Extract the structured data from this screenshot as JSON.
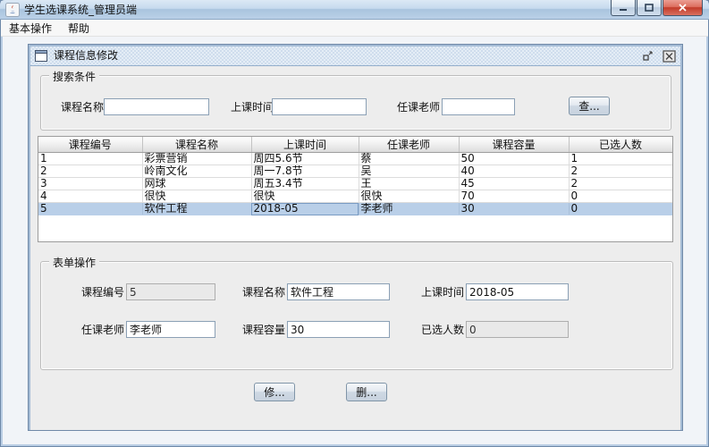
{
  "window": {
    "title": "学生选课系统_管理员端"
  },
  "menu": {
    "items": [
      {
        "label": "基本操作"
      },
      {
        "label": "帮助"
      }
    ]
  },
  "frame": {
    "title": "课程信息修改",
    "search": {
      "title": "搜索条件",
      "course_name_label": "课程名称",
      "course_name_value": "",
      "time_label": "上课时间",
      "time_value": "",
      "teacher_label": "任课老师",
      "teacher_value": "",
      "search_button": "查..."
    },
    "table": {
      "columns": [
        "课程编号",
        "课程名称",
        "上课时间",
        "任课老师",
        "课程容量",
        "已选人数"
      ],
      "rows": [
        [
          "1",
          "彩票营销",
          "周四5.6节",
          "蔡",
          "50",
          "1"
        ],
        [
          "2",
          "岭南文化",
          "周一7.8节",
          "吴",
          "40",
          "2"
        ],
        [
          "3",
          "网球",
          "周五3.4节",
          "王",
          "45",
          "2"
        ],
        [
          "4",
          "很快",
          "很快",
          "很快",
          "70",
          "0"
        ],
        [
          "5",
          "软件工程",
          "2018-05",
          "李老师",
          "30",
          "0"
        ]
      ],
      "selected_row_index": 4,
      "focused_cell": {
        "row": 4,
        "col": 2
      }
    },
    "form": {
      "title": "表单操作",
      "course_id_label": "课程编号",
      "course_id_value": "5",
      "course_name_label": "课程名称",
      "course_name_value": "软件工程",
      "time_label": "上课时间",
      "time_value": "2018-05",
      "teacher_label": "任课老师",
      "teacher_value": "李老师",
      "capacity_label": "课程容量",
      "capacity_value": "30",
      "selected_label": "已选人数",
      "selected_value": "0",
      "modify_button": "修...",
      "delete_button": "删..."
    }
  },
  "colors": {
    "selection": "#b9cfe8",
    "close_button": "#c23b2a",
    "frame_border": "#7089a8",
    "titlebar_gradient_top": "#dce9f5",
    "titlebar_gradient_bottom": "#bad0e7"
  }
}
